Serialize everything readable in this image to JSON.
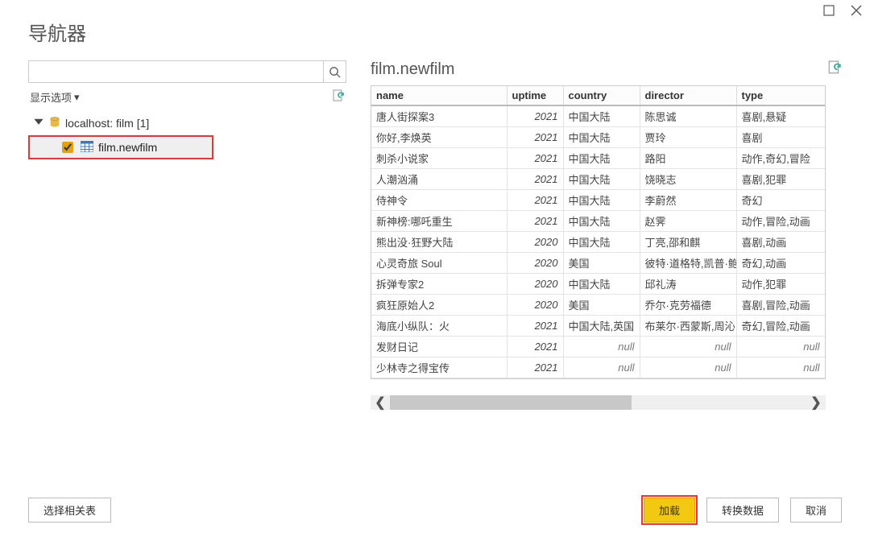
{
  "dialog": {
    "title": "导航器"
  },
  "left": {
    "search_placeholder": "",
    "options_label": "显示选项",
    "tree_root_label": "localhost: film [1]",
    "tree_child_label": "film.newfilm",
    "tree_child_checked": true
  },
  "preview": {
    "title": "film.newfilm",
    "columns": [
      "name",
      "uptime",
      "country",
      "director",
      "type"
    ],
    "rows": [
      {
        "name": "唐人街探案3",
        "uptime": 2021,
        "country": "中国大陆",
        "director": "陈思诚",
        "type": "喜剧,悬疑"
      },
      {
        "name": "你好,李焕英",
        "uptime": 2021,
        "country": "中国大陆",
        "director": "贾玲",
        "type": "喜剧"
      },
      {
        "name": "刺杀小说家",
        "uptime": 2021,
        "country": "中国大陆",
        "director": "路阳",
        "type": "动作,奇幻,冒险"
      },
      {
        "name": "人潮汹涌",
        "uptime": 2021,
        "country": "中国大陆",
        "director": "饶晓志",
        "type": "喜剧,犯罪"
      },
      {
        "name": "侍神令",
        "uptime": 2021,
        "country": "中国大陆",
        "director": "李蔚然",
        "type": "奇幻"
      },
      {
        "name": "新神榜:哪吒重生",
        "uptime": 2021,
        "country": "中国大陆",
        "director": "赵霁",
        "type": "动作,冒险,动画"
      },
      {
        "name": "熊出没·狂野大陆",
        "uptime": 2020,
        "country": "中国大陆",
        "director": "丁亮,邵和麒",
        "type": "喜剧,动画"
      },
      {
        "name": "心灵奇旅 Soul",
        "uptime": 2020,
        "country": "美国",
        "director": "彼特·道格特,凯普·鲍",
        "type": "奇幻,动画"
      },
      {
        "name": "拆弹专家2",
        "uptime": 2020,
        "country": "中国大陆",
        "director": "邱礼涛",
        "type": "动作,犯罪"
      },
      {
        "name": "疯狂原始人2",
        "uptime": 2020,
        "country": "美国",
        "director": "乔尔·克劳福德",
        "type": "喜剧,冒险,动画"
      },
      {
        "name": "海底小纵队：火",
        "uptime": 2021,
        "country": "中国大陆,英国",
        "director": "布莱尔·西蒙斯,周沁",
        "type": "奇幻,冒险,动画"
      },
      {
        "name": "发财日记",
        "uptime": 2021,
        "country": null,
        "director": null,
        "type": null
      },
      {
        "name": "少林寺之得宝传",
        "uptime": 2021,
        "country": null,
        "director": null,
        "type": null
      }
    ],
    "null_label": "null"
  },
  "footer": {
    "select_related": "选择相关表",
    "load": "加载",
    "transform": "转换数据",
    "cancel": "取消"
  }
}
